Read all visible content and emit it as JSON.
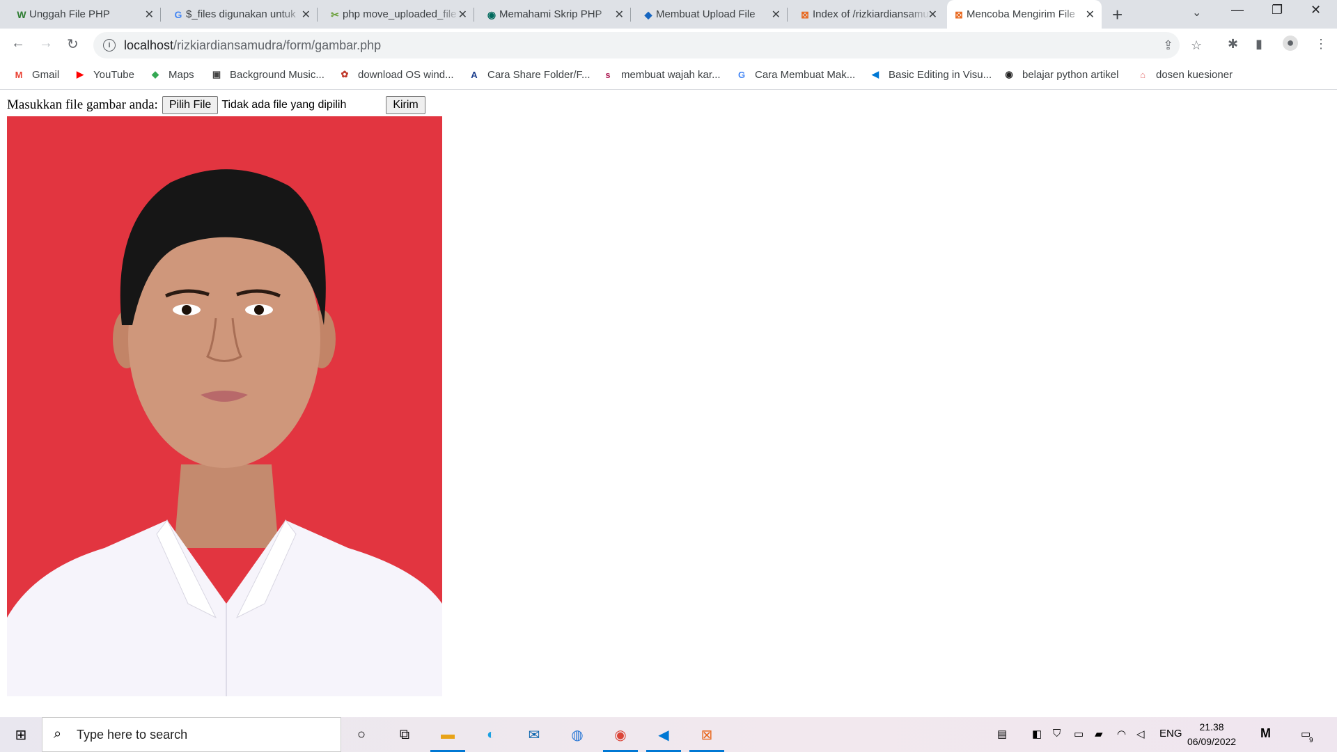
{
  "browser": {
    "tabs": [
      {
        "title": "Unggah File PHP",
        "icon": "wikihow-icon",
        "icon_char": "W"
      },
      {
        "title": "$_files digunakan untuk",
        "icon": "google-icon",
        "icon_char": "G"
      },
      {
        "title": "php move_uploaded_file",
        "icon": "site-icon",
        "icon_char": "✂"
      },
      {
        "title": "Memahami Skrip PHP",
        "icon": "site-icon",
        "icon_char": "◉"
      },
      {
        "title": "Membuat Upload File",
        "icon": "site-icon",
        "icon_char": "◆"
      },
      {
        "title": "Index of /rizkiardiansamudra",
        "icon": "xampp-icon",
        "icon_char": "⊠"
      },
      {
        "title": "Mencoba Mengirim File",
        "icon": "xampp-icon",
        "icon_char": "⊠",
        "active": true
      }
    ],
    "url_host": "localhost",
    "url_path": "/rizkiardiansamudra/form/gambar.php",
    "bookmarks": [
      {
        "label": "Gmail",
        "icon_char": "M",
        "color": "#ea4335"
      },
      {
        "label": "YouTube",
        "icon_char": "▶",
        "color": "#ff0000"
      },
      {
        "label": "Maps",
        "icon_char": "◆",
        "color": "#34a853"
      },
      {
        "label": "Background Music...",
        "icon_char": "▣",
        "color": "#444444"
      },
      {
        "label": "download OS wind...",
        "icon_char": "✿",
        "color": "#c0392b"
      },
      {
        "label": "Cara Share Folder/F...",
        "icon_char": "A",
        "color": "#1a3c8c"
      },
      {
        "label": "membuat wajah kar...",
        "icon_char": "s",
        "color": "#b0245a"
      },
      {
        "label": "Cara Membuat Mak...",
        "icon_char": "G",
        "color": "#4285f4"
      },
      {
        "label": "Basic Editing in Visu...",
        "icon_char": "◀",
        "color": "#0078d4"
      },
      {
        "label": "belajar python artikel",
        "icon_char": "◉",
        "color": "#222222"
      },
      {
        "label": "dosen kuesioner",
        "icon_char": "⌂",
        "color": "#e57373"
      }
    ]
  },
  "page": {
    "label": "Masukkan file gambar anda:",
    "choose_button": "Pilih File",
    "no_file": "Tidak ada file yang dipilih",
    "submit_button": "Kirim"
  },
  "taskbar": {
    "search_placeholder": "Type here to search",
    "language": "ENG",
    "time": "21.38",
    "date": "06/09/2022",
    "notification_count": "9"
  }
}
